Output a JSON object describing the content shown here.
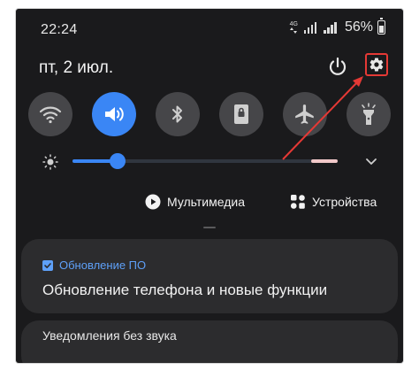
{
  "status_bar": {
    "time": "22:24",
    "network_type": "4G",
    "battery_percent": "56%"
  },
  "header": {
    "date": "пт, 2 июл."
  },
  "icons": {
    "power": "power-icon",
    "settings": "gear-icon",
    "wifi": "wifi-icon",
    "sound": "sound-icon",
    "bluetooth": "bluetooth-icon",
    "rotation": "screen-rotation-icon",
    "airplane": "airplane-icon",
    "flashlight": "flashlight-icon"
  },
  "quick_toggles": [
    {
      "name": "wifi",
      "active": false
    },
    {
      "name": "sound",
      "active": true
    },
    {
      "name": "bluetooth",
      "active": false
    },
    {
      "name": "rotation",
      "active": false
    },
    {
      "name": "airplane",
      "active": false
    },
    {
      "name": "flashlight",
      "active": false
    }
  ],
  "brightness": {
    "level_fraction": 0.17
  },
  "media_panel": {
    "media_label": "Мультимедиа",
    "devices_label": "Устройства"
  },
  "notifications": [
    {
      "app": "Обновление ПО",
      "title": "Обновление телефона и новые функции"
    }
  ],
  "silent_section": {
    "label": "Уведомления без звука"
  },
  "colors": {
    "accent": "#3a86f5",
    "background": "#1a1a1c",
    "card": "#2c2c2e",
    "annotation": "#e53935"
  }
}
